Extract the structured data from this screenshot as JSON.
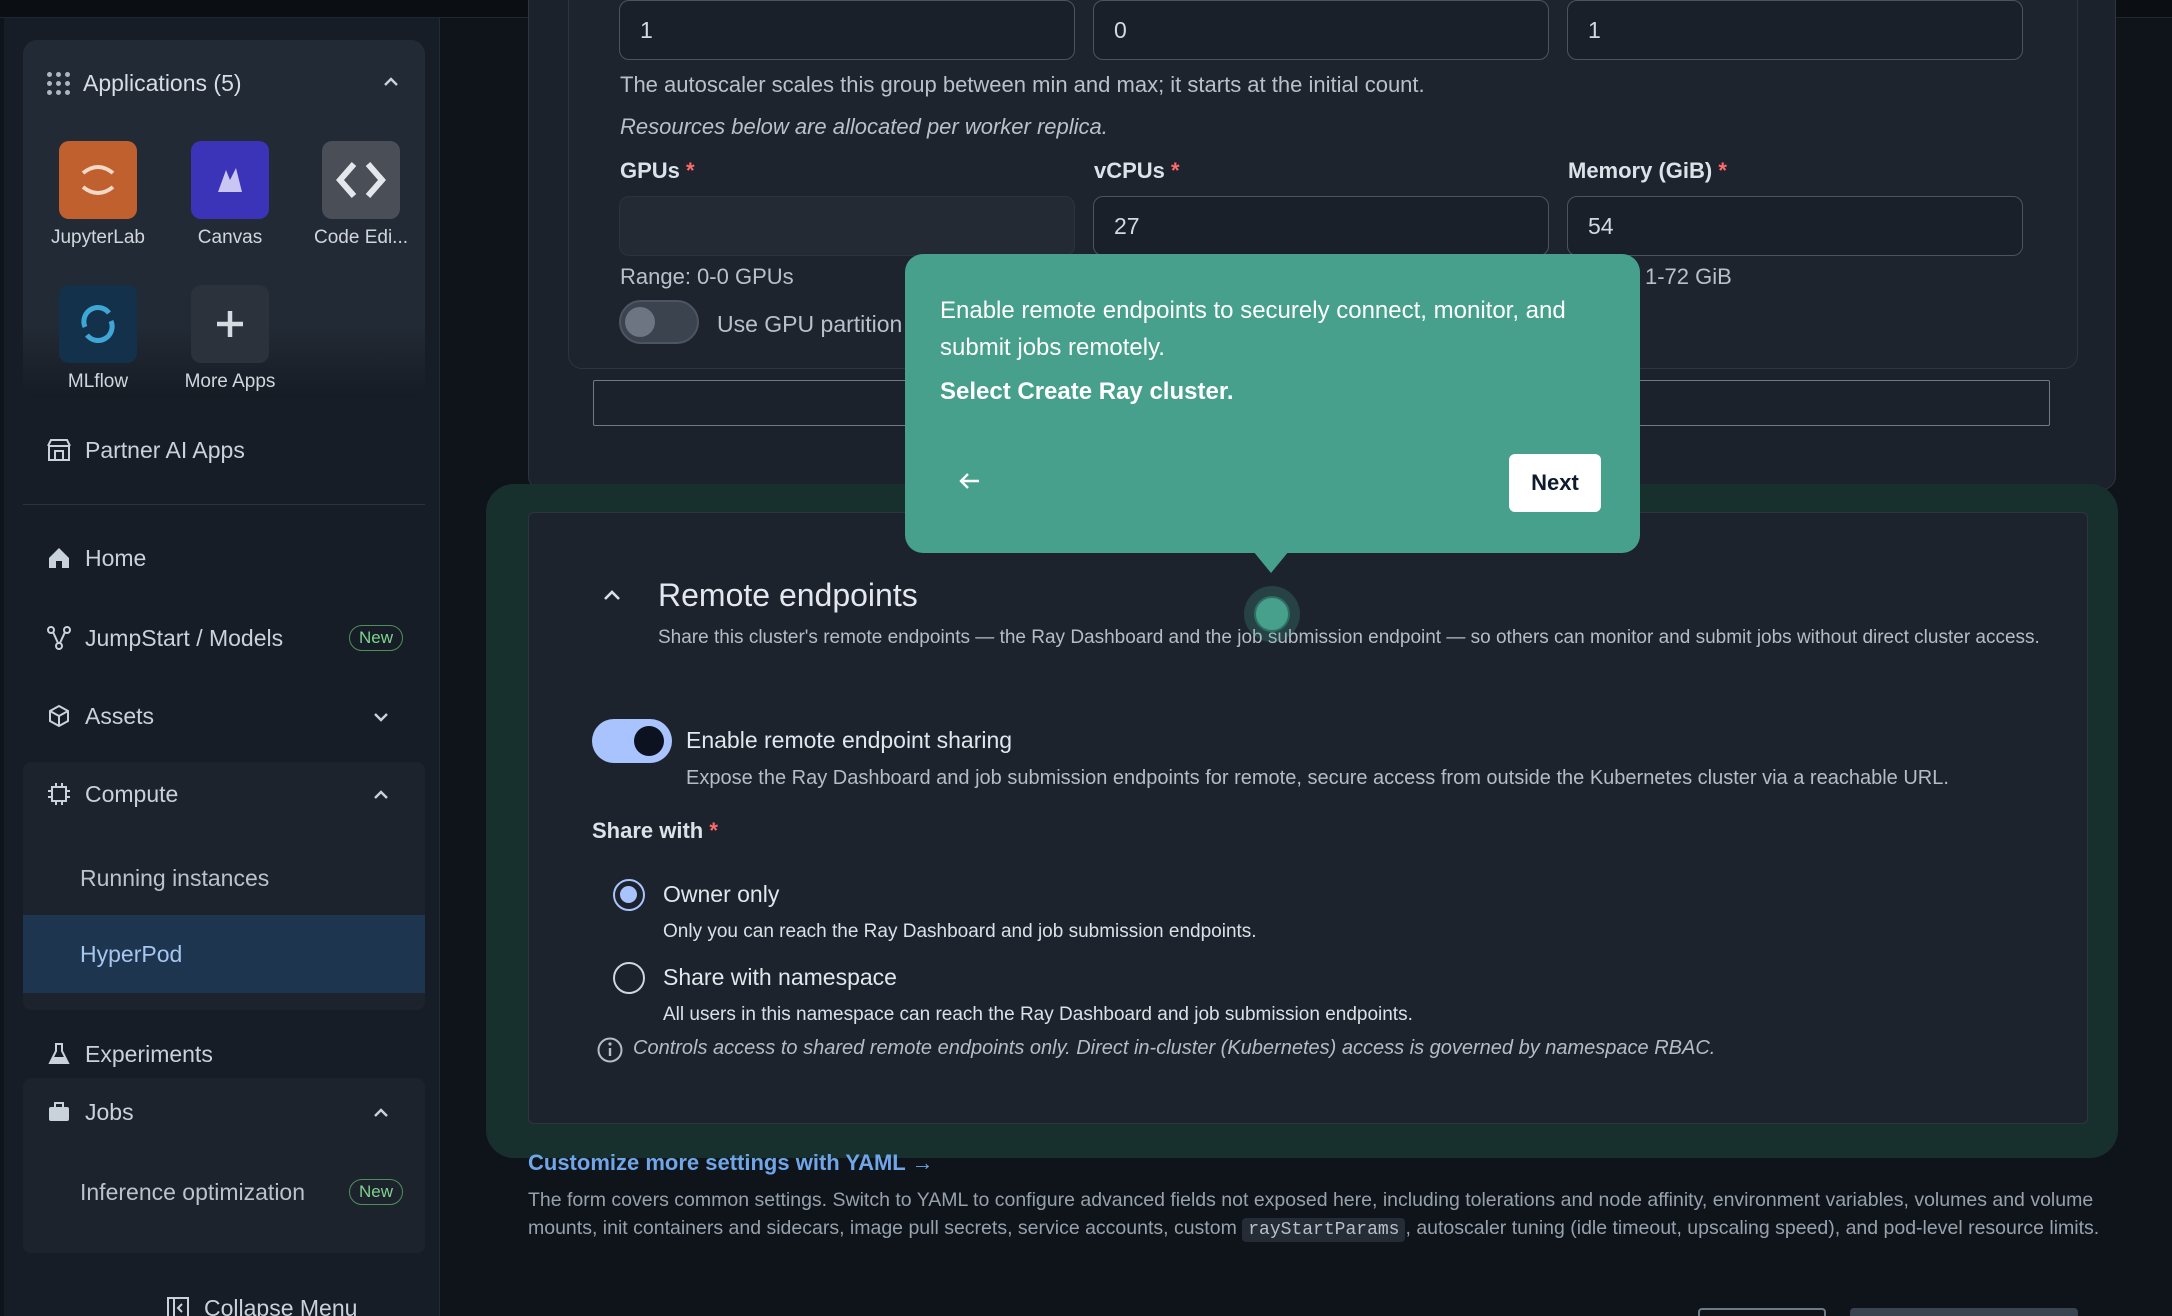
{
  "sidebar": {
    "apps_title": "Applications (5)",
    "apps": [
      {
        "label": "JupyterLab",
        "icon": "jupyterlab-icon"
      },
      {
        "label": "Canvas",
        "icon": "canvas-icon"
      },
      {
        "label": "Code Edi...",
        "icon": "code-editor-icon"
      },
      {
        "label": "MLflow",
        "icon": "mlflow-icon"
      },
      {
        "label": "More Apps",
        "icon": "plus-icon"
      }
    ],
    "partner": "Partner AI Apps",
    "home": "Home",
    "jumpstart": "JumpStart / Models",
    "jumpstart_badge": "New",
    "assets": "Assets",
    "compute": "Compute",
    "running_instances": "Running instances",
    "hyperpod": "HyperPod",
    "experiments": "Experiments",
    "jobs": "Jobs",
    "inference_optimization": "Inference optimization",
    "inference_badge": "New",
    "collapse": "Collapse Menu"
  },
  "worker_group": {
    "counts": [
      "1",
      "0",
      "1"
    ],
    "autoscaler_help": "The autoscaler scales this group between min and max; it starts at the initial count.",
    "per_replica_note": "Resources below are allocated per worker replica.",
    "gpus_label": "GPUs",
    "vcpus_label": "vCPUs",
    "memory_label": "Memory (GiB)",
    "vcpus_value": "27",
    "memory_value": "54",
    "gpu_range": "Range: 0-0 GPUs",
    "memory_range": "1-72 GiB",
    "gpu_partition_label": "Use GPU partition"
  },
  "tooltip": {
    "body": "Enable remote endpoints to securely connect, monitor, and submit jobs remotely.",
    "action": "Select Create Ray cluster.",
    "next": "Next"
  },
  "remote": {
    "title": "Remote endpoints",
    "description": "Share this cluster's remote endpoints — the Ray Dashboard and the job submission endpoint — so others can monitor and submit jobs without direct cluster access.",
    "toggle_label": "Enable remote endpoint sharing",
    "toggle_help": "Expose the Ray Dashboard and job submission endpoints for remote, secure access from outside the Kubernetes cluster via a reachable URL.",
    "share_with_label": "Share with",
    "owner_only": "Owner only",
    "owner_only_help": "Only you can reach the Ray Dashboard and job submission endpoints.",
    "share_namespace": "Share with namespace",
    "share_namespace_help": "All users in this namespace can reach the Ray Dashboard and job submission endpoints.",
    "info_note": "Controls access to shared remote endpoints only. Direct in-cluster (Kubernetes) access is governed by namespace RBAC."
  },
  "yaml": {
    "link": "Customize more settings with YAML →",
    "text_1": "The form covers common settings. Switch to YAML to configure advanced fields not exposed here, including tolerations and node affinity, environment variables, volumes and volume mounts, init containers and sidecars, image pull secrets, service accounts, custom",
    "code": "rayStartParams",
    "text_2": ", autoscaler tuning (idle timeout, upscaling speed), and pod-level resource limits."
  },
  "colors": {
    "accent": "#46a08c",
    "toggle_on": "#a9c3ff",
    "required": "#ff6b6b"
  }
}
